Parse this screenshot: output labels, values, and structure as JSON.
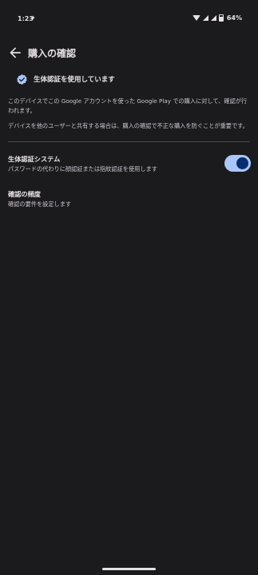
{
  "status_bar": {
    "time": "1:23",
    "spark_glyph": "✦",
    "battery": "64%"
  },
  "header": {
    "title": "購入の確認",
    "back_icon": "arrow-back-icon"
  },
  "biometric_status": {
    "icon": "verified-check-icon",
    "text": "生体認証を使用しています",
    "icon_color": "#a8c7fa"
  },
  "description": {
    "paragraph1": "このデバイスでこの Google アカウントを使った Google Play での購入に対して、確認が行われます。",
    "paragraph2": "デバイスを他のユーザーと共有する場合は、購入の確認で不正な購入を防ぐことが重要です。"
  },
  "settings": {
    "biometric": {
      "title": "生体認証システム",
      "subtitle": "パスワードの代わりに顔認証または指紋認証を使用します",
      "toggle_on": true
    },
    "frequency": {
      "title": "確認の頻度",
      "subtitle": "確認の要件を設定します"
    }
  },
  "colors": {
    "background": "#1b1b1d",
    "accent": "#a8c7fa",
    "toggle_knob": "#062e6f"
  }
}
